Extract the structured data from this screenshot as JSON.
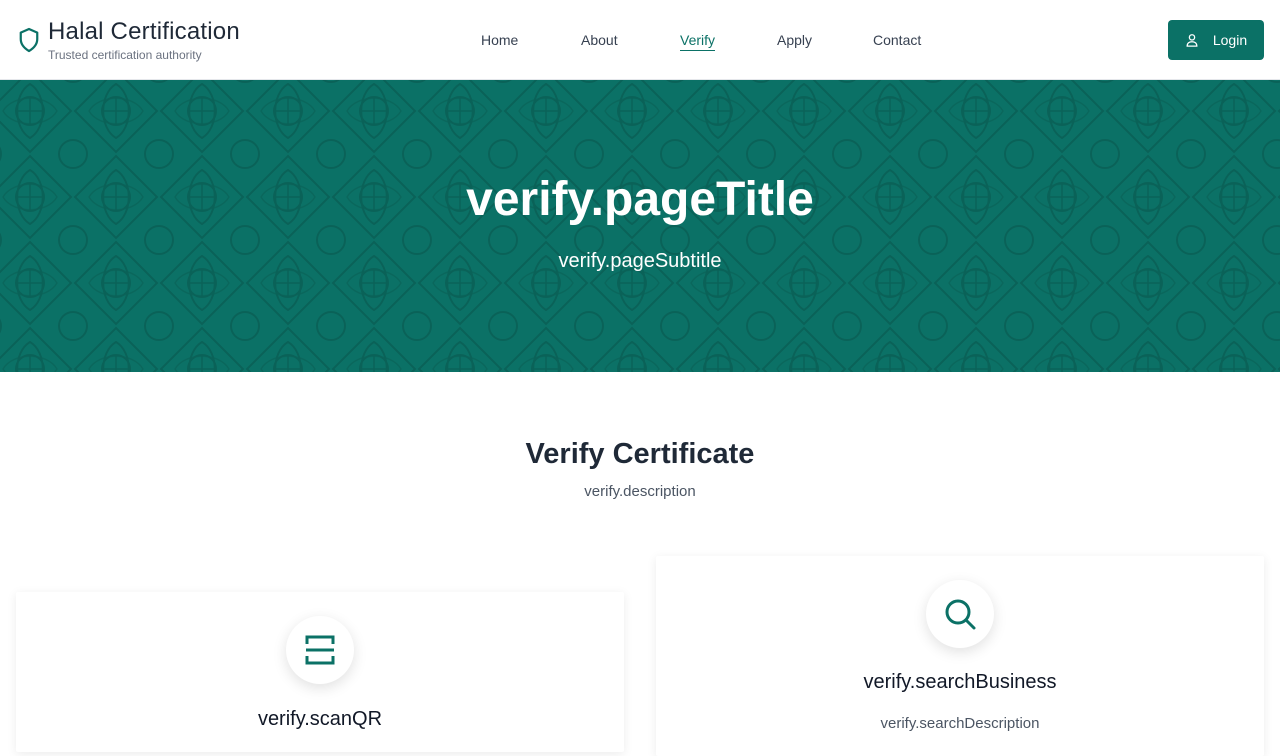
{
  "brand": {
    "title": "Halal Certification",
    "subtitle": "Trusted certification authority",
    "icon": "shield-icon"
  },
  "nav": {
    "items": [
      {
        "label": "Home"
      },
      {
        "label": "About"
      },
      {
        "label": "Verify",
        "active": true
      },
      {
        "label": "Apply"
      },
      {
        "label": "Contact"
      }
    ]
  },
  "login": {
    "label": "Login",
    "icon": "user-icon"
  },
  "hero": {
    "title": "verify.pageTitle",
    "subtitle": "verify.pageSubtitle"
  },
  "section": {
    "title": "Verify Certificate",
    "description": "verify.description"
  },
  "cards": {
    "scan": {
      "heading": "verify.scanQR",
      "icon": "qr-scan-icon"
    },
    "search": {
      "heading": "verify.searchBusiness",
      "text": "verify.searchDescription",
      "icon": "search-icon"
    }
  },
  "colors": {
    "primary": "#0b7166",
    "text": "#1f2937",
    "muted": "#6b7280"
  }
}
